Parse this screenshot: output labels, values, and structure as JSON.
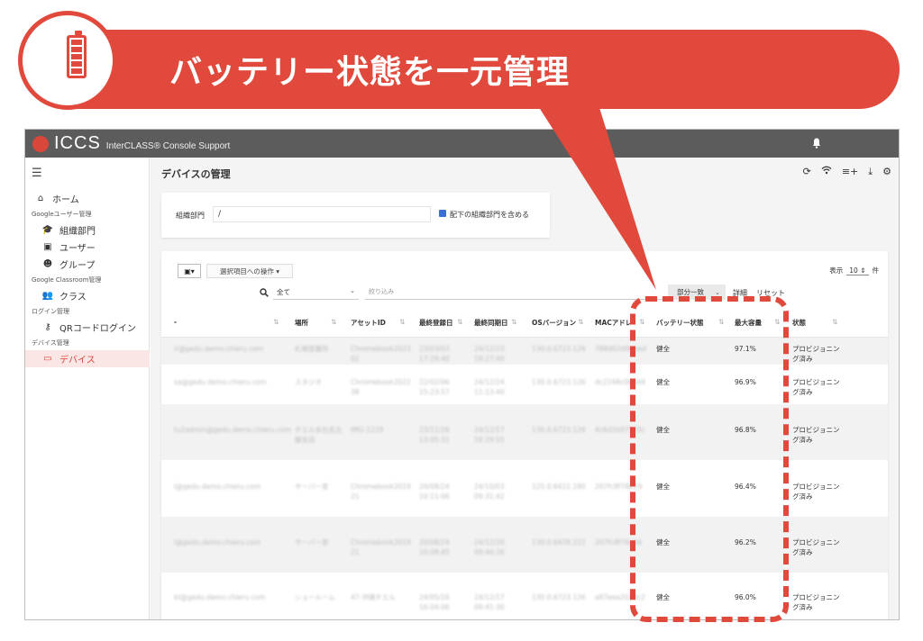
{
  "banner": {
    "title": "バッテリー状態を一元管理",
    "icon": "battery-icon",
    "color": "#e0493b"
  },
  "app": {
    "brand": "ICCS",
    "brand_sub": "InterCLASS® Console Support",
    "accent": "#d9463a",
    "topbar_color": "#5c5c5c"
  },
  "sidebar": {
    "items": [
      {
        "type": "item",
        "icon": "home-icon",
        "glyph": "⌂",
        "label": "ホーム"
      },
      {
        "type": "section",
        "label": "Googleユーザー管理"
      },
      {
        "type": "child",
        "icon": "graduation-cap-icon",
        "glyph": "🎓",
        "label": "組織部門"
      },
      {
        "type": "child",
        "icon": "user-card-icon",
        "glyph": "▣",
        "label": "ユーザー"
      },
      {
        "type": "child",
        "icon": "group-icon",
        "glyph": "☻",
        "label": "グループ"
      },
      {
        "type": "section",
        "label": "Google Classroom管理"
      },
      {
        "type": "child",
        "icon": "class-icon",
        "glyph": "👥",
        "label": "クラス"
      },
      {
        "type": "section",
        "label": "ログイン管理"
      },
      {
        "type": "child",
        "icon": "key-icon",
        "glyph": "⚷",
        "label": "QRコードログイン"
      },
      {
        "type": "section",
        "label": "デバイス管理"
      },
      {
        "type": "child",
        "icon": "laptop-icon",
        "glyph": "▭",
        "label": "デバイス",
        "active": true
      }
    ]
  },
  "main": {
    "page_title": "デバイスの管理",
    "filter": {
      "label": "組織部門",
      "value": "/",
      "include_sub_label": "配下の組織部門を含める",
      "include_sub_checked": true
    },
    "toolbar": {
      "bulk_action_label": "選択項目への操作 ▾",
      "page_size_prefix": "表示",
      "page_size": "10",
      "page_size_suffix": "件",
      "scope_value": "全て",
      "narrow_placeholder": "絞り込み",
      "match_value": "部分一致",
      "detail_label": "詳細",
      "reset_label": "リセット"
    },
    "columns": [
      {
        "key": "email",
        "label": "-"
      },
      {
        "key": "location",
        "label": "場所"
      },
      {
        "key": "asset",
        "label": "アセットID"
      },
      {
        "key": "registered",
        "label": "最終登録日"
      },
      {
        "key": "synced",
        "label": "最終同期日"
      },
      {
        "key": "os",
        "label": "OSバージョン"
      },
      {
        "key": "mac",
        "label": "MACアドレ"
      },
      {
        "key": "battery",
        "label": "バッテリー状態"
      },
      {
        "key": "capacity",
        "label": "最大容量"
      },
      {
        "key": "status",
        "label": "状態"
      }
    ],
    "rows": [
      {
        "email": "ir@gedu.demo.chieru.com",
        "location": "札幌営業所",
        "asset": "Chromebook2023 02",
        "registered": "23/03/03 17:28:40",
        "synced": "24/12/23 18:27:40",
        "os": "130.0.6723.126",
        "mac": "788d02d9bbed",
        "battery": "健全",
        "capacity": "97.1%",
        "status": "プロビジョニング済み"
      },
      {
        "email": "sa@gedu.demo.chieru.com",
        "location": "スタジオ",
        "asset": "Chromebook2022 38",
        "registered": "22/02/06 15:23:57",
        "synced": "24/12/24 11:13:40",
        "os": "130.0.6723.126",
        "mac": "dc2248c0b0d4",
        "battery": "健全",
        "capacity": "96.9%",
        "status": "プロビジョニング済み"
      },
      {
        "email": "tu2admin@gedu.demo.chieru.com",
        "location": "チエル本社名古屋支店",
        "asset": "IMG-1229",
        "registered": "23/11/26 13:05:31",
        "synced": "24/12/17 16:29:55",
        "os": "130.0.6723.126",
        "mac": "4c6d2b97520c",
        "battery": "健全",
        "capacity": "96.8%",
        "status": "プロビジョニング済み"
      },
      {
        "email": "l@gedu.demo.chieru.com",
        "location": "サーバー室",
        "asset": "Chromebook2019 21",
        "registered": "20/08/24 10:11:06",
        "synced": "24/10/03 09:31:42",
        "os": "125.0.6422.180",
        "mac": "207fc8f78b29",
        "battery": "健全",
        "capacity": "96.4%",
        "status": "プロビジョニング済み"
      },
      {
        "email": "l@gedu.demo.chieru.com",
        "location": "サーバー室",
        "asset": "Chromebook2019 21",
        "registered": "20/08/24 10:08:45",
        "synced": "24/12/20 09:44:26",
        "os": "130.0.6478.222",
        "mac": "207fc8f76e56",
        "battery": "健全",
        "capacity": "96.2%",
        "status": "プロビジョニング済み"
      },
      {
        "email": "kt@gedu.demo.chieru.com",
        "location": "ショールーム",
        "asset": "47-沖縄チエル",
        "registered": "24/05/16 16:04:06",
        "synced": "24/12/17 09:41:30",
        "os": "130.0.6723.126",
        "mac": "a87eea2020c2",
        "battery": "健全",
        "capacity": "96.0%",
        "status": "プロビジョニング済み"
      }
    ]
  }
}
